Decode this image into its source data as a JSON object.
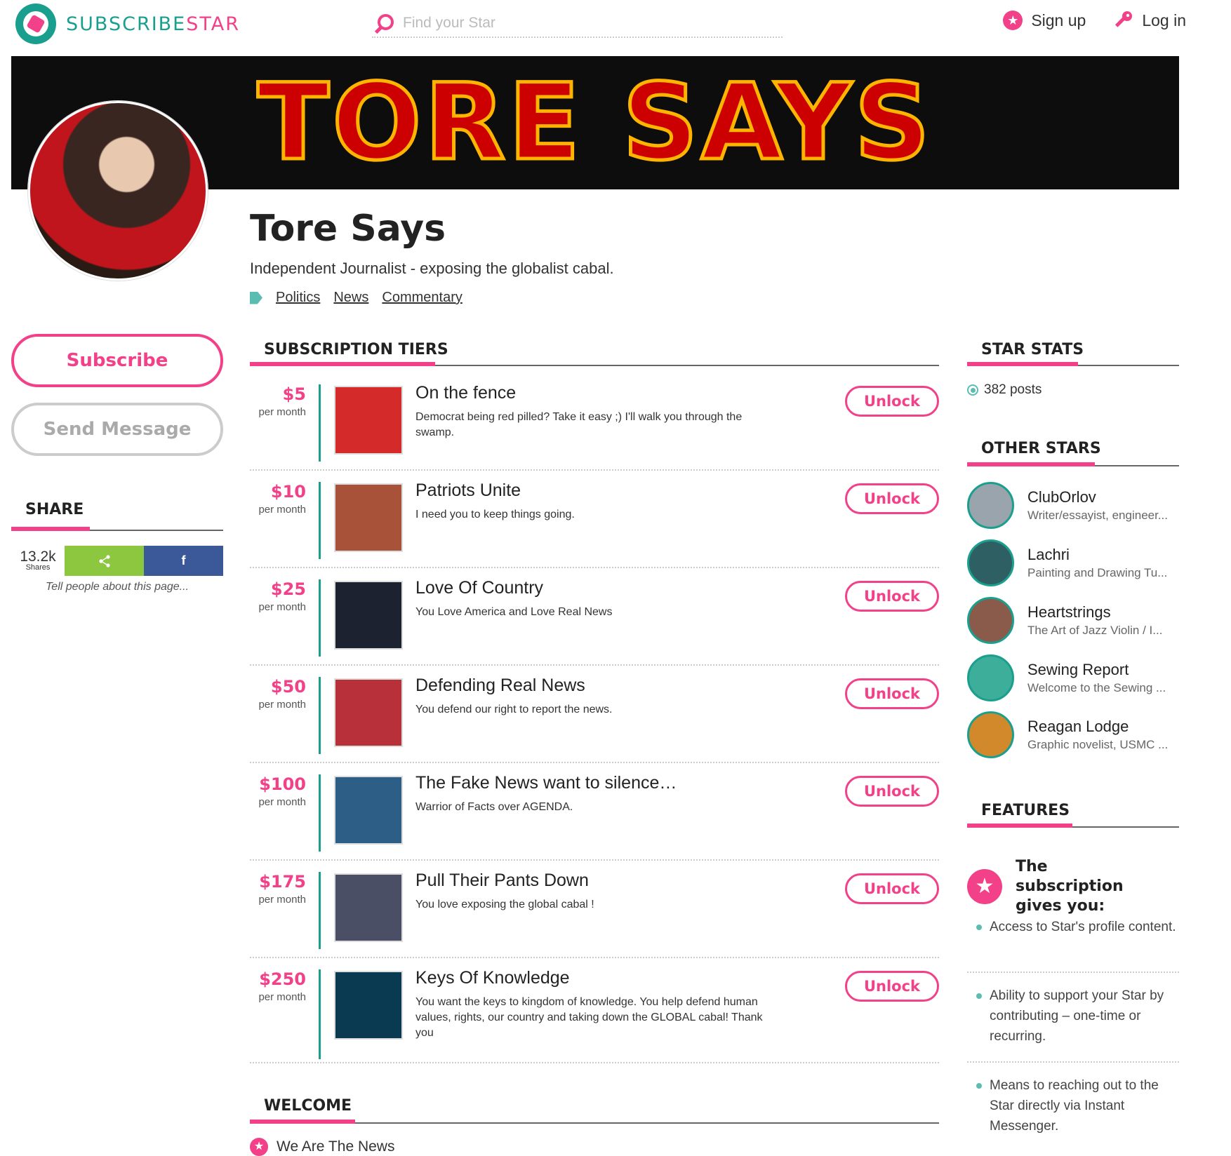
{
  "header": {
    "logo_primary": "SUBSCRIBE",
    "logo_accent": "STAR",
    "search_placeholder": "Find your Star",
    "signup_label": "Sign up",
    "login_label": "Log in"
  },
  "banner": {
    "title": "TORE SAYS"
  },
  "profile": {
    "name": "Tore Says",
    "tagline": "Independent Journalist - exposing the globalist cabal.",
    "tags": [
      "Politics",
      "News",
      "Commentary"
    ]
  },
  "actions": {
    "subscribe": "Subscribe",
    "send_message": "Send Message"
  },
  "share": {
    "heading": "SHARE",
    "count": "13.2k",
    "count_label": "Shares",
    "facebook_glyph": "f",
    "hint": "Tell people about this page..."
  },
  "tiers": {
    "heading": "SUBSCRIPTION TIERS",
    "per_label": "per month",
    "unlock_label": "Unlock",
    "items": [
      {
        "price": "$5",
        "title": "On the fence",
        "desc": "Democrat being red pilled? Take it easy ;) I'll walk you through the swamp.",
        "img_color": "#d42a2a"
      },
      {
        "price": "$10",
        "title": "Patriots Unite",
        "desc": "I need you to keep things going.",
        "img_color": "#a8523a"
      },
      {
        "price": "$25",
        "title": "Love Of Country",
        "desc": "You Love America and Love Real News",
        "img_color": "#1c2230"
      },
      {
        "price": "$50",
        "title": "Defending Real News",
        "desc": "You defend our right to report the news.",
        "img_color": "#b8303a"
      },
      {
        "price": "$100",
        "title": "The Fake News want to silence…",
        "desc": "Warrior of Facts over AGENDA.",
        "img_color": "#2d5f86"
      },
      {
        "price": "$175",
        "title": "Pull Their Pants Down",
        "desc": "You love exposing the global cabal !",
        "img_color": "#4a4f66"
      },
      {
        "price": "$250",
        "title": "Keys Of Knowledge",
        "desc": "You want the keys to kingdom of knowledge. You help defend human values, rights, our country and taking down the GLOBAL cabal! Thank you",
        "img_color": "#0a3a52"
      }
    ]
  },
  "star_stats": {
    "heading": "STAR STATS",
    "posts": "382 posts"
  },
  "other_stars": {
    "heading": "OTHER STARS",
    "items": [
      {
        "name": "ClubOrlov",
        "sub": "Writer/essayist, engineer...",
        "color": "#9aa4ad"
      },
      {
        "name": "Lachri",
        "sub": "Painting and Drawing Tu...",
        "color": "#2e5f62"
      },
      {
        "name": "Heartstrings",
        "sub": "The Art of Jazz Violin / I...",
        "color": "#8a5a4a"
      },
      {
        "name": "Sewing Report",
        "sub": "Welcome to the Sewing ...",
        "color": "#3cae9a"
      },
      {
        "name": "Reagan Lodge",
        "sub": "Graphic novelist, USMC ...",
        "color": "#d2892c"
      }
    ]
  },
  "features": {
    "heading": "FEATURES",
    "title": "The subscription gives you:",
    "items": [
      "Access to Star's profile content.",
      "Ability to support your Star by contributing – one-time or recurring.",
      "Means to reaching out to the Star directly via Instant Messenger."
    ]
  },
  "welcome": {
    "heading": "WELCOME",
    "item": "We Are The News"
  },
  "colors": {
    "accent": "#f24089",
    "brand": "#1a9f8e"
  }
}
